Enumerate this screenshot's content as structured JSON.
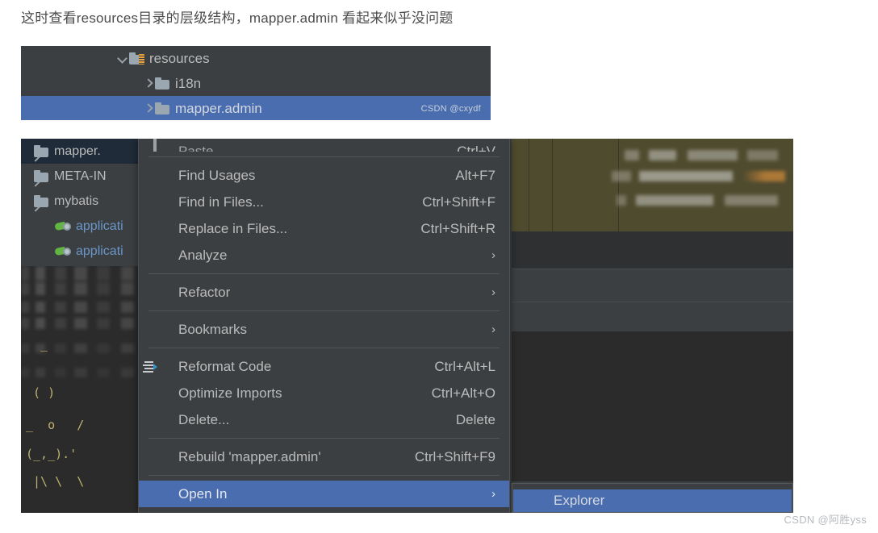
{
  "caption": "这时查看resources目录的层级结构，mapper.admin 看起来似乎没问题",
  "tree_panel": {
    "watermark": "CSDN @cxydf",
    "rows": [
      {
        "label": "resources",
        "twist": "chevron-down-icon",
        "icon": "resources-folder-icon",
        "indent": 118,
        "selected": false
      },
      {
        "label": "i18n",
        "twist": "chevron-right-icon",
        "icon": "folder-icon",
        "indent": 150,
        "selected": false
      },
      {
        "label": "mapper.admin",
        "twist": "chevron-right-icon",
        "icon": "folder-icon",
        "indent": 150,
        "selected": true
      }
    ]
  },
  "project_tree": {
    "rows": [
      {
        "label": "mapper.",
        "type": "folder",
        "twist": "chevron-right-icon",
        "selected": true
      },
      {
        "label": "META-IN",
        "type": "folder",
        "twist": "chevron-right-icon",
        "selected": false
      },
      {
        "label": "mybatis",
        "type": "folder",
        "twist": "chevron-right-icon",
        "selected": false
      },
      {
        "label": "applicati",
        "type": "file",
        "icon": "spring-config-icon",
        "selected": false
      },
      {
        "label": "applicati",
        "type": "file",
        "icon": "spring-config-icon",
        "selected": false
      }
    ],
    "console_ascii": [
      "  _",
      " ( )",
      "_  o   /",
      "(_,_).'",
      " |\\ \\  \\"
    ]
  },
  "context_menu": {
    "items": [
      {
        "label": "Paste",
        "mnemonic": "P",
        "accel": "Ctrl+V",
        "icon": "paste-icon",
        "clipped": true,
        "arrow": false,
        "highlighted": false
      },
      {
        "sep": true
      },
      {
        "label": "Find Usages",
        "mnemonic": "U",
        "accel": "Alt+F7",
        "arrow": false,
        "highlighted": false
      },
      {
        "label": "Find in Files...",
        "accel": "Ctrl+Shift+F",
        "arrow": false,
        "highlighted": false
      },
      {
        "label": "Replace in Files...",
        "mnemonic": "a",
        "accel": "Ctrl+Shift+R",
        "arrow": false,
        "highlighted": false
      },
      {
        "label": "Analyze",
        "mnemonic": "z",
        "accel": "",
        "arrow": true,
        "highlighted": false
      },
      {
        "sep": true
      },
      {
        "label": "Refactor",
        "mnemonic": "R",
        "accel": "",
        "arrow": true,
        "highlighted": false
      },
      {
        "sep": true
      },
      {
        "label": "Bookmarks",
        "accel": "",
        "arrow": true,
        "highlighted": false
      },
      {
        "sep": true
      },
      {
        "label": "Reformat Code",
        "mnemonic": "R",
        "accel": "Ctrl+Alt+L",
        "icon": "reformat-code-icon",
        "arrow": false,
        "highlighted": false
      },
      {
        "label": "Optimize Imports",
        "mnemonic": "z",
        "accel": "Ctrl+Alt+O",
        "arrow": false,
        "highlighted": false
      },
      {
        "label": "Delete...",
        "mnemonic": "D",
        "accel": "Delete",
        "arrow": false,
        "highlighted": false
      },
      {
        "sep": true
      },
      {
        "label": "Rebuild 'mapper.admin'",
        "mnemonic": "e",
        "accel": "Ctrl+Shift+F9",
        "arrow": false,
        "highlighted": false
      },
      {
        "sep": true
      },
      {
        "label": "Open In",
        "accel": "",
        "arrow": true,
        "highlighted": true
      }
    ]
  },
  "submenu": {
    "items": [
      {
        "label": "Explorer",
        "highlighted": true
      }
    ]
  },
  "watermark_bottom": "CSDN @阿胜yss",
  "colors": {
    "menu_bg": "#3C3F41",
    "selection_blue": "#4A6DAF",
    "text": "#BBBBBB",
    "separator": "#515557",
    "tree_selected_dark": "#1F2B38",
    "console_bg": "#2B2B2B",
    "olive_panel": "#4F4B2F",
    "folder_gray": "#9AA7B0",
    "resource_orange": "#E8A33D",
    "spring_green": "#62B543",
    "file_blue": "#6A96C8"
  }
}
